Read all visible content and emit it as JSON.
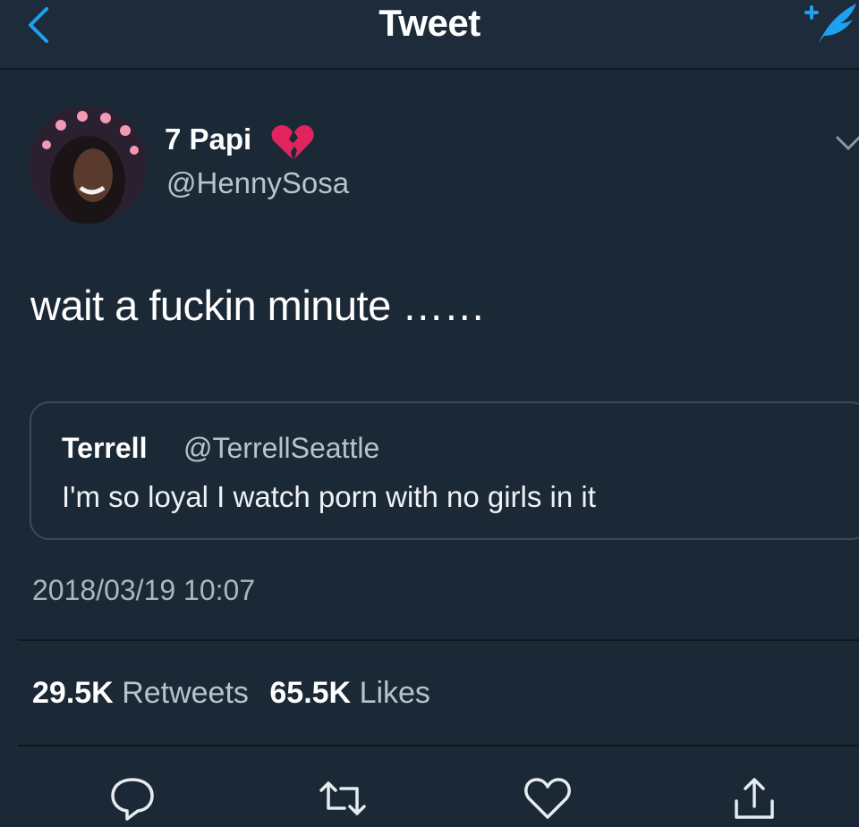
{
  "nav": {
    "title": "Tweet",
    "back_icon": "chevron-left-icon",
    "compose_icon": "compose-tweet-icon"
  },
  "tweet": {
    "author": {
      "display_name": "7 Papi",
      "name_emoji": "broken-heart-icon",
      "handle": "@HennySosa"
    },
    "text": "wait a fuckin minute ……",
    "quoted": {
      "name": "Terrell",
      "handle": "@TerrellSeattle",
      "text": "I'm so loyal I watch porn with no girls in it"
    },
    "timestamp": "2018/03/19 10:07",
    "stats": {
      "retweets_count": "29.5K",
      "retweets_label": "Retweets",
      "likes_count": "65.5K",
      "likes_label": "Likes"
    }
  },
  "actions": [
    "reply-icon",
    "retweet-icon",
    "like-icon",
    "share-icon"
  ],
  "colors": {
    "background": "#1b2836",
    "accent": "#1da1f2",
    "secondary_text": "#b9c3cd",
    "heart_red": "#e0245e"
  }
}
